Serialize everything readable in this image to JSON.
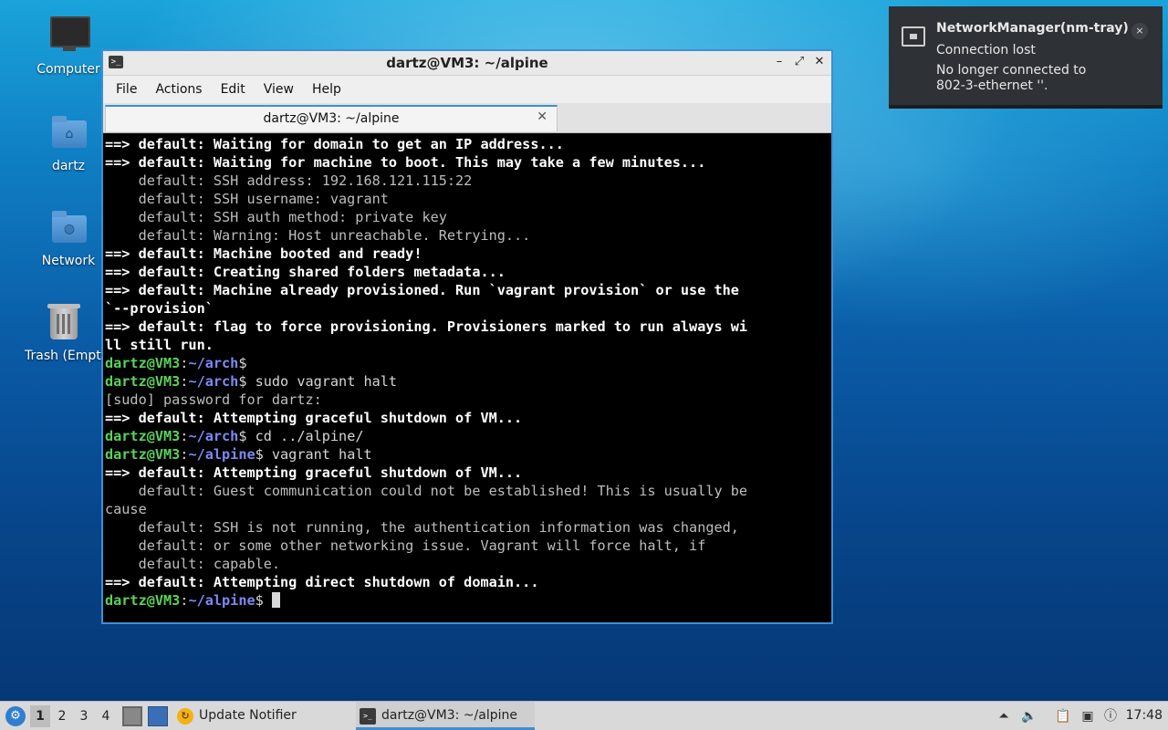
{
  "desktop": {
    "icons": [
      {
        "label": "Computer"
      },
      {
        "label": "dartz"
      },
      {
        "label": "Network"
      },
      {
        "label": "Trash (Empty)"
      }
    ]
  },
  "window": {
    "title": "dartz@VM3: ~/alpine",
    "menu": [
      "File",
      "Actions",
      "Edit",
      "View",
      "Help"
    ],
    "tab_label": "dartz@VM3: ~/alpine"
  },
  "terminal": {
    "lines": [
      [
        {
          "c": "b",
          "t": "==> default: Waiting for domain to get an IP address..."
        }
      ],
      [
        {
          "c": "b",
          "t": "==> default: Waiting for machine to boot. This may take a few minutes..."
        }
      ],
      [
        {
          "c": "d",
          "t": "    default: SSH address: 192.168.121.115:22"
        }
      ],
      [
        {
          "c": "d",
          "t": "    default: SSH username: vagrant"
        }
      ],
      [
        {
          "c": "d",
          "t": "    default: SSH auth method: private key"
        }
      ],
      [
        {
          "c": "d",
          "t": "    default: Warning: Host unreachable. Retrying..."
        }
      ],
      [
        {
          "c": "b",
          "t": "==> default: Machine booted and ready!"
        }
      ],
      [
        {
          "c": "b",
          "t": "==> default: Creating shared folders metadata..."
        }
      ],
      [
        {
          "c": "b",
          "t": "==> default: Machine already provisioned. Run `vagrant provision` or use the"
        }
      ],
      [
        {
          "c": "b",
          "t": "`--provision`"
        }
      ],
      [
        {
          "c": "b",
          "t": "==> default: flag to force provisioning. Provisioners marked to run always wi"
        }
      ],
      [
        {
          "c": "b",
          "t": "ll still run."
        }
      ],
      [
        {
          "c": "u",
          "t": "dartz@VM3"
        },
        {
          "c": "t",
          "t": ":"
        },
        {
          "c": "p",
          "t": "~/arch"
        },
        {
          "c": "t",
          "t": "$"
        }
      ],
      [
        {
          "c": "u",
          "t": "dartz@VM3"
        },
        {
          "c": "t",
          "t": ":"
        },
        {
          "c": "p",
          "t": "~/arch"
        },
        {
          "c": "t",
          "t": "$ sudo vagrant halt"
        }
      ],
      [
        {
          "c": "d",
          "t": "[sudo] password for dartz:"
        }
      ],
      [
        {
          "c": "b",
          "t": "==> default: Attempting graceful shutdown of VM..."
        }
      ],
      [
        {
          "c": "u",
          "t": "dartz@VM3"
        },
        {
          "c": "t",
          "t": ":"
        },
        {
          "c": "p",
          "t": "~/arch"
        },
        {
          "c": "t",
          "t": "$ cd ../alpine/"
        }
      ],
      [
        {
          "c": "u",
          "t": "dartz@VM3"
        },
        {
          "c": "t",
          "t": ":"
        },
        {
          "c": "p",
          "t": "~/alpine"
        },
        {
          "c": "t",
          "t": "$ vagrant halt"
        }
      ],
      [
        {
          "c": "b",
          "t": "==> default: Attempting graceful shutdown of VM..."
        }
      ],
      [
        {
          "c": "d",
          "t": "    default: Guest communication could not be established! This is usually be"
        }
      ],
      [
        {
          "c": "d",
          "t": "cause"
        }
      ],
      [
        {
          "c": "d",
          "t": "    default: SSH is not running, the authentication information was changed,"
        }
      ],
      [
        {
          "c": "d",
          "t": "    default: or some other networking issue. Vagrant will force halt, if"
        }
      ],
      [
        {
          "c": "d",
          "t": "    default: capable."
        }
      ],
      [
        {
          "c": "b",
          "t": "==> default: Attempting direct shutdown of domain..."
        }
      ],
      [
        {
          "c": "u",
          "t": "dartz@VM3"
        },
        {
          "c": "t",
          "t": ":"
        },
        {
          "c": "p",
          "t": "~/alpine"
        },
        {
          "c": "t",
          "t": "$ "
        }
      ]
    ]
  },
  "notification": {
    "title": "NetworkManager(nm-tray)",
    "summary": "Connection lost",
    "body": "No longer connected to\n802-3-ethernet ''.",
    "close": "×"
  },
  "taskbar": {
    "workspaces": [
      "1",
      "2",
      "3",
      "4"
    ],
    "active_workspace": "1",
    "tasks": [
      {
        "label": "Update Notifier"
      },
      {
        "label": "dartz@VM3: ~/alpine"
      }
    ],
    "clock": "17:48"
  },
  "icons": {
    "start": "start-menu-icon",
    "terminal": "terminal-icon",
    "network_tray": "network-wired-icon",
    "volume": "volume-icon",
    "clipboard": "clipboard-icon",
    "update": "update-notifier-icon"
  },
  "colors": {
    "accent": "#3d8fd6",
    "prompt_user": "#5ad25a",
    "prompt_path": "#7c89f5",
    "notification_bg": "#2e3136"
  }
}
